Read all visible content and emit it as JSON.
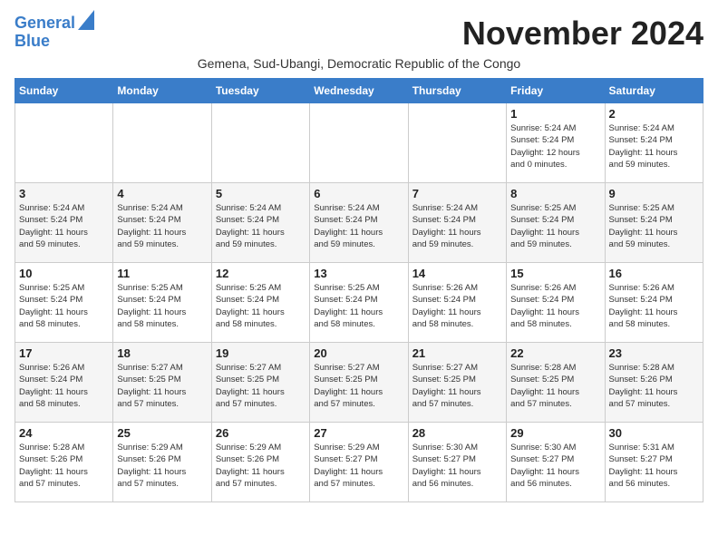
{
  "logo": {
    "line1": "General",
    "line2": "Blue"
  },
  "title": "November 2024",
  "subtitle": "Gemena, Sud-Ubangi, Democratic Republic of the Congo",
  "days_of_week": [
    "Sunday",
    "Monday",
    "Tuesday",
    "Wednesday",
    "Thursday",
    "Friday",
    "Saturday"
  ],
  "weeks": [
    [
      {
        "day": "",
        "info": ""
      },
      {
        "day": "",
        "info": ""
      },
      {
        "day": "",
        "info": ""
      },
      {
        "day": "",
        "info": ""
      },
      {
        "day": "",
        "info": ""
      },
      {
        "day": "1",
        "info": "Sunrise: 5:24 AM\nSunset: 5:24 PM\nDaylight: 12 hours\nand 0 minutes."
      },
      {
        "day": "2",
        "info": "Sunrise: 5:24 AM\nSunset: 5:24 PM\nDaylight: 11 hours\nand 59 minutes."
      }
    ],
    [
      {
        "day": "3",
        "info": "Sunrise: 5:24 AM\nSunset: 5:24 PM\nDaylight: 11 hours\nand 59 minutes."
      },
      {
        "day": "4",
        "info": "Sunrise: 5:24 AM\nSunset: 5:24 PM\nDaylight: 11 hours\nand 59 minutes."
      },
      {
        "day": "5",
        "info": "Sunrise: 5:24 AM\nSunset: 5:24 PM\nDaylight: 11 hours\nand 59 minutes."
      },
      {
        "day": "6",
        "info": "Sunrise: 5:24 AM\nSunset: 5:24 PM\nDaylight: 11 hours\nand 59 minutes."
      },
      {
        "day": "7",
        "info": "Sunrise: 5:24 AM\nSunset: 5:24 PM\nDaylight: 11 hours\nand 59 minutes."
      },
      {
        "day": "8",
        "info": "Sunrise: 5:25 AM\nSunset: 5:24 PM\nDaylight: 11 hours\nand 59 minutes."
      },
      {
        "day": "9",
        "info": "Sunrise: 5:25 AM\nSunset: 5:24 PM\nDaylight: 11 hours\nand 59 minutes."
      }
    ],
    [
      {
        "day": "10",
        "info": "Sunrise: 5:25 AM\nSunset: 5:24 PM\nDaylight: 11 hours\nand 58 minutes."
      },
      {
        "day": "11",
        "info": "Sunrise: 5:25 AM\nSunset: 5:24 PM\nDaylight: 11 hours\nand 58 minutes."
      },
      {
        "day": "12",
        "info": "Sunrise: 5:25 AM\nSunset: 5:24 PM\nDaylight: 11 hours\nand 58 minutes."
      },
      {
        "day": "13",
        "info": "Sunrise: 5:25 AM\nSunset: 5:24 PM\nDaylight: 11 hours\nand 58 minutes."
      },
      {
        "day": "14",
        "info": "Sunrise: 5:26 AM\nSunset: 5:24 PM\nDaylight: 11 hours\nand 58 minutes."
      },
      {
        "day": "15",
        "info": "Sunrise: 5:26 AM\nSunset: 5:24 PM\nDaylight: 11 hours\nand 58 minutes."
      },
      {
        "day": "16",
        "info": "Sunrise: 5:26 AM\nSunset: 5:24 PM\nDaylight: 11 hours\nand 58 minutes."
      }
    ],
    [
      {
        "day": "17",
        "info": "Sunrise: 5:26 AM\nSunset: 5:24 PM\nDaylight: 11 hours\nand 58 minutes."
      },
      {
        "day": "18",
        "info": "Sunrise: 5:27 AM\nSunset: 5:25 PM\nDaylight: 11 hours\nand 57 minutes."
      },
      {
        "day": "19",
        "info": "Sunrise: 5:27 AM\nSunset: 5:25 PM\nDaylight: 11 hours\nand 57 minutes."
      },
      {
        "day": "20",
        "info": "Sunrise: 5:27 AM\nSunset: 5:25 PM\nDaylight: 11 hours\nand 57 minutes."
      },
      {
        "day": "21",
        "info": "Sunrise: 5:27 AM\nSunset: 5:25 PM\nDaylight: 11 hours\nand 57 minutes."
      },
      {
        "day": "22",
        "info": "Sunrise: 5:28 AM\nSunset: 5:25 PM\nDaylight: 11 hours\nand 57 minutes."
      },
      {
        "day": "23",
        "info": "Sunrise: 5:28 AM\nSunset: 5:26 PM\nDaylight: 11 hours\nand 57 minutes."
      }
    ],
    [
      {
        "day": "24",
        "info": "Sunrise: 5:28 AM\nSunset: 5:26 PM\nDaylight: 11 hours\nand 57 minutes."
      },
      {
        "day": "25",
        "info": "Sunrise: 5:29 AM\nSunset: 5:26 PM\nDaylight: 11 hours\nand 57 minutes."
      },
      {
        "day": "26",
        "info": "Sunrise: 5:29 AM\nSunset: 5:26 PM\nDaylight: 11 hours\nand 57 minutes."
      },
      {
        "day": "27",
        "info": "Sunrise: 5:29 AM\nSunset: 5:27 PM\nDaylight: 11 hours\nand 57 minutes."
      },
      {
        "day": "28",
        "info": "Sunrise: 5:30 AM\nSunset: 5:27 PM\nDaylight: 11 hours\nand 56 minutes."
      },
      {
        "day": "29",
        "info": "Sunrise: 5:30 AM\nSunset: 5:27 PM\nDaylight: 11 hours\nand 56 minutes."
      },
      {
        "day": "30",
        "info": "Sunrise: 5:31 AM\nSunset: 5:27 PM\nDaylight: 11 hours\nand 56 minutes."
      }
    ]
  ]
}
